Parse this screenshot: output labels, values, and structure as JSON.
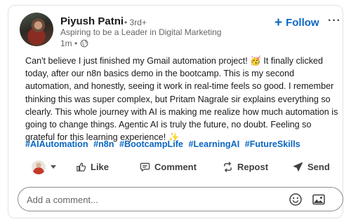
{
  "author": {
    "name": "Piyush Patni",
    "degree": "• 3rd+",
    "headline": "Aspiring to be a Leader in Digital Marketing",
    "time": "1m •"
  },
  "actions_top": {
    "follow_label": "Follow",
    "follow_icon": "plus-icon",
    "more_label": "···"
  },
  "post": {
    "lines": [
      "Can't believe I just finished my Gmail automation project! 🥳 It finally clicked",
      "today, after our n8n basics demo in the bootcamp. This is my second",
      "automation, and honestly, seeing it work in real-time feels so good. I remember",
      "thinking this was super complex, but Pritam Nagrale sir explains everything so",
      "clearly. This whole journey with AI is making me realize how much automation is",
      "going to change things. Agentic AI is truly the future, no doubt. Feeling so",
      "grateful for this learning experience! ✨"
    ],
    "hashtags": [
      "#AIAutomation",
      "#n8n",
      "#BootcampLife",
      "#LearningAI",
      "#FutureSkills"
    ]
  },
  "social_actions": {
    "like": "Like",
    "comment": "Comment",
    "repost": "Repost",
    "send": "Send"
  },
  "comment_box": {
    "placeholder": "Add a comment...",
    "emoji_icon": "emoji-icon",
    "image_icon": "image-icon"
  },
  "colors": {
    "accent": "#0a66c2",
    "text": "#191919",
    "muted": "#666666"
  }
}
